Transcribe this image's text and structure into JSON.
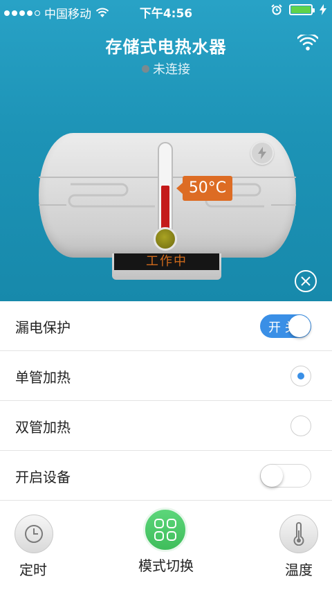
{
  "status_bar": {
    "carrier": "中国移动",
    "time": "下午4:56"
  },
  "header": {
    "title": "存储式电热水器",
    "connection_status": "未连接"
  },
  "heater": {
    "temperature_label": "50°C",
    "temperature_level": 0.5,
    "display_text": "工作中"
  },
  "settings": {
    "leakage_protection": {
      "label": "漏电保护",
      "toggle_text": "开 关",
      "on": true
    },
    "single_tube_heating": {
      "label": "单管加热",
      "selected": true
    },
    "double_tube_heating": {
      "label": "双管加热",
      "selected": false
    },
    "open_device": {
      "label": "开启设备",
      "on": false
    }
  },
  "tabs": {
    "timer": "定时",
    "mode_switch": "模式切换",
    "temperature": "温度"
  },
  "colors": {
    "header_blue": "#1d93b6",
    "accent_blue": "#3a8fe6",
    "temp_tag_orange": "#dd6c24",
    "mode_green": "#4ecb6a"
  }
}
